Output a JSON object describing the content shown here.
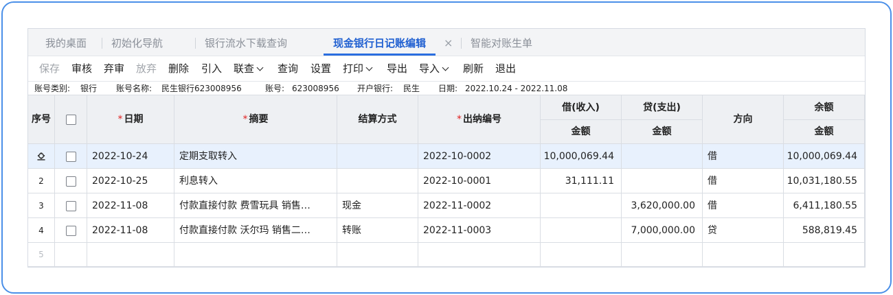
{
  "tabs": [
    {
      "label": "我的桌面"
    },
    {
      "label": "初始化导航"
    },
    {
      "label": "银行流水下载查询"
    },
    {
      "label": "现金银行日记账编辑",
      "active": true
    },
    {
      "label": "智能对账生单"
    }
  ],
  "toolbar": {
    "save": "保存",
    "audit": "审核",
    "unaudit": "弃审",
    "discard": "放弃",
    "delete": "删除",
    "import_ref": "引入",
    "link_query": "联查",
    "query": "查询",
    "settings": "设置",
    "print": "打印",
    "export": "导出",
    "import": "导入",
    "refresh": "刷新",
    "exit": "退出"
  },
  "info": {
    "account_type_label": "账号类别:",
    "account_type": "银行",
    "account_name_label": "账号名称:",
    "account_name": "民生银行623008956",
    "account_no_label": "账号:",
    "account_no": "623008956",
    "bank_label": "开户银行:",
    "bank": "民生",
    "date_label": "日期:",
    "date_range": "2022.10.24 - 2022.11.08"
  },
  "table": {
    "headers": {
      "seq": "序号",
      "date": "日期",
      "summary": "摘要",
      "settle": "结算方式",
      "voucher": "出纳编号",
      "debit": "借(收入)",
      "credit": "贷(支出)",
      "direction": "方向",
      "balance": "余额",
      "amount": "金额"
    },
    "rows": [
      {
        "seq": "",
        "date": "2022-10-24",
        "summary": "定期支取转入",
        "settle": "",
        "voucher": "2022-10-0002",
        "debit": "10,000,069.44",
        "credit": "",
        "direction": "借",
        "balance": "10,000,069.44"
      },
      {
        "seq": "2",
        "date": "2022-10-25",
        "summary": "利息转入",
        "settle": "",
        "voucher": "2022-10-0001",
        "debit": "31,111.11",
        "credit": "",
        "direction": "借",
        "balance": "10,031,180.55"
      },
      {
        "seq": "3",
        "date": "2022-11-08",
        "summary": "付款直接付款 费雪玩具 销售…",
        "settle": "现金",
        "voucher": "2022-11-0002",
        "debit": "",
        "credit": "3,620,000.00",
        "direction": "借",
        "balance": "6,411,180.55"
      },
      {
        "seq": "4",
        "date": "2022-11-08",
        "summary": "付款直接付款 沃尔玛 销售二…",
        "settle": "转账",
        "voucher": "2022-11-0003",
        "debit": "",
        "credit": "7,000,000.00",
        "direction": "贷",
        "balance": "588,819.45"
      }
    ],
    "empty_row_seq": "5"
  },
  "colors": {
    "accent": "#2a6ee0",
    "frame": "#4a8fe8",
    "selected_row": "#e8f1fd",
    "required": "#e02020"
  }
}
